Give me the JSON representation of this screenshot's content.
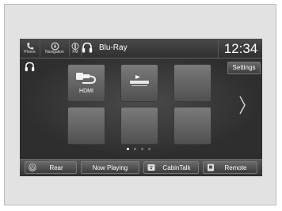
{
  "topbar": {
    "buttons": [
      {
        "label": "Phone",
        "icon": "phone-icon"
      },
      {
        "label": "Navigation",
        "icon": "navigation-icon"
      },
      {
        "label": "FM",
        "icon": "fm-radio-icon"
      }
    ],
    "source_icon": "headphones-icon",
    "source": "Blu-Ray",
    "clock": "12:34"
  },
  "main": {
    "icon": "headphones-icon",
    "settings_label": "Settings",
    "tiles": [
      {
        "label": "HDMI",
        "icon": "hdmi-plug-icon"
      },
      {
        "label": "",
        "icon": "blu-ray-disc-icon"
      },
      {
        "label": "",
        "icon": ""
      },
      {
        "label": "",
        "icon": ""
      },
      {
        "label": "",
        "icon": ""
      },
      {
        "label": "",
        "icon": ""
      }
    ],
    "next_icon": "chevron-right-icon",
    "page_indicator": {
      "pages": 4,
      "current": 1
    }
  },
  "bottombar": {
    "buttons": [
      {
        "label": "Rear",
        "icon": "power-icon"
      },
      {
        "label": "Now Playing",
        "icon": ""
      },
      {
        "label": "CabinTalk",
        "icon": "cabintalk-icon"
      },
      {
        "label": "Remote",
        "icon": "remote-icon"
      }
    ]
  },
  "colors": {
    "screen_bg": "#2c2c2c",
    "tile": "#666666",
    "text": "#ffffff"
  }
}
